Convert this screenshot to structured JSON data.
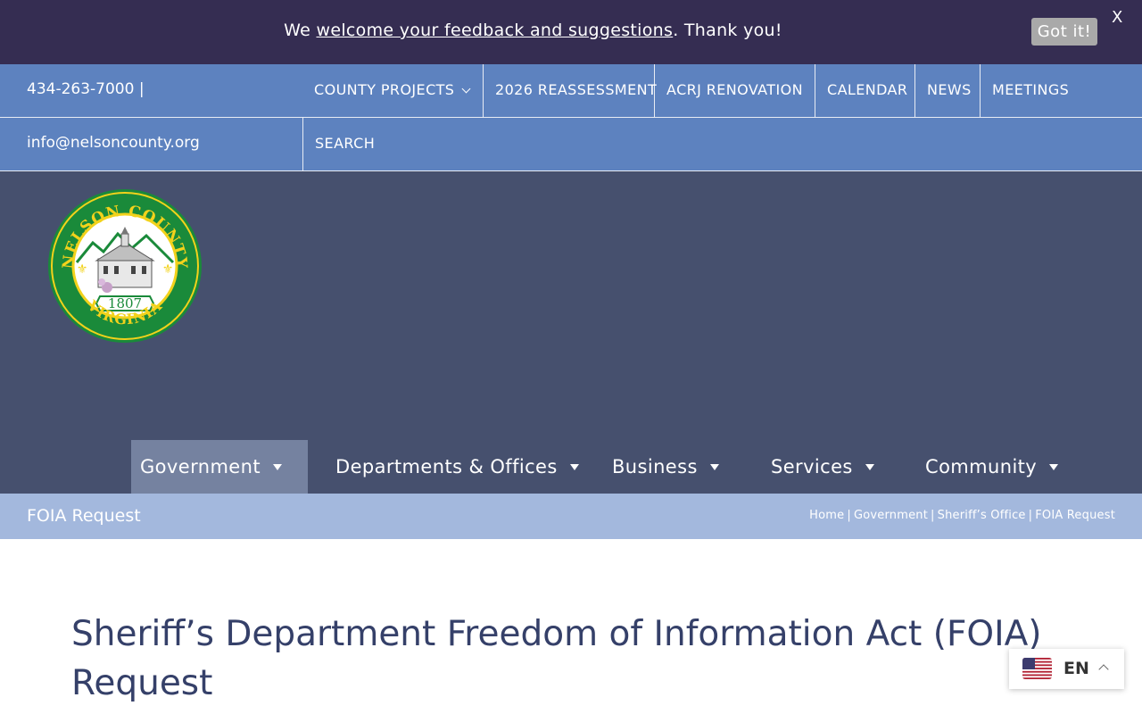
{
  "notice": {
    "prefix": "We ",
    "link": "welcome your feedback and suggestions",
    "suffix": ". Thank you!",
    "button": "Got it!",
    "close": "X"
  },
  "contact": {
    "phone": "434-263-7000 |",
    "email": "info@nelsoncounty.org"
  },
  "top_nav": {
    "items": [
      {
        "label": "COUNTY PROJECTS",
        "has_dropdown": true
      },
      {
        "label": "2026 REASSESSMENT"
      },
      {
        "label": "ACRJ RENOVATION"
      },
      {
        "label": "CALENDAR"
      },
      {
        "label": "NEWS"
      },
      {
        "label": "MEETINGS"
      }
    ],
    "search": "SEARCH"
  },
  "logo": {
    "top_text": "NELSON COUNTY",
    "bottom_text": "VIRGINIA",
    "year": "1807"
  },
  "main_nav": {
    "items": [
      {
        "label": "Government",
        "active": true
      },
      {
        "label": "Departments & Offices"
      },
      {
        "label": "Business"
      },
      {
        "label": "Services"
      },
      {
        "label": "Community"
      }
    ]
  },
  "title_bar": {
    "label": "FOIA Request",
    "breadcrumb": [
      "Home",
      "Government",
      "Sheriff’s Office",
      "FOIA Request"
    ],
    "separator": "|"
  },
  "content": {
    "heading": "Sheriff’s Department Freedom of Information Act (FOIA) Request"
  },
  "language": {
    "code": "EN",
    "flag": "us-flag-icon"
  },
  "colors": {
    "notice_bg": "#352d52",
    "topnav_bg": "#5d82bf",
    "header_bg": "#46506e",
    "titlebar_bg": "#a3b8dd",
    "heading": "#354069",
    "logo_green": "#1a8a3a",
    "logo_gold": "#f2d21b"
  }
}
